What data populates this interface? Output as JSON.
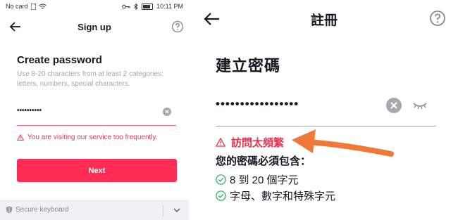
{
  "status_bar": {
    "carrier": "No card",
    "time": "10:11 PM"
  },
  "left": {
    "title": "Sign up",
    "heading": "Create password",
    "description": "Use 8-20 characters from at least 2 categories: letters, numbers, special characters.",
    "password_masked": "••••••••••",
    "warning": "You are visiting our service too frequently.",
    "next_label": "Next",
    "keyboard_label": "Secure keyboard"
  },
  "right": {
    "title": "註冊",
    "heading": "建立密碼",
    "password_masked": "•••••••••••••••••",
    "warning": "訪問太頻繁",
    "must_include": "您的密碼必須包含：",
    "requirements": [
      "8 到 20 個字元",
      "字母、數字和特殊字元"
    ]
  },
  "colors": {
    "accent": "#fe2c55",
    "warning": "#e8344e",
    "check": "#25b864",
    "arrow": "#f0793a"
  }
}
